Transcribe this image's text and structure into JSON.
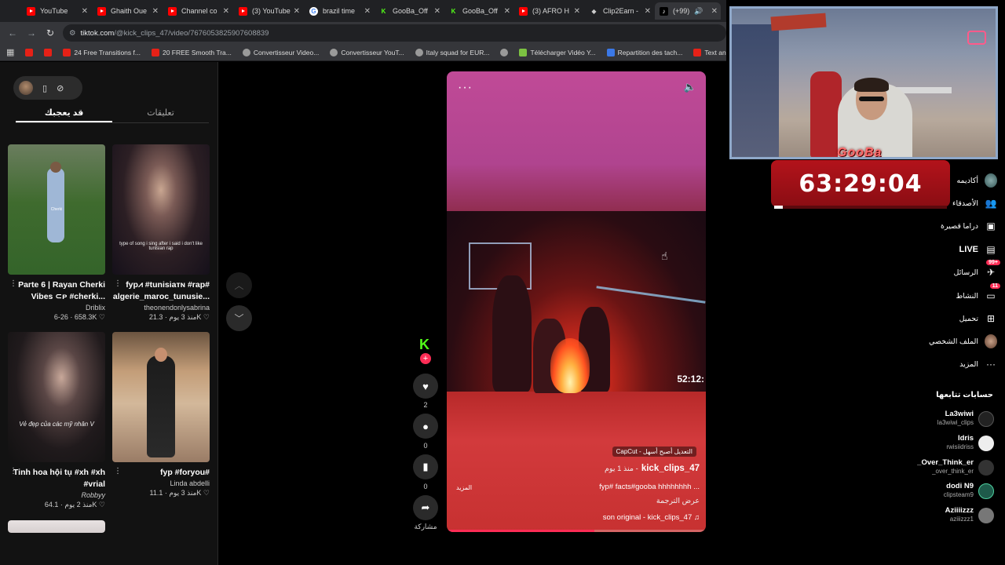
{
  "browser": {
    "tabs": [
      {
        "label": "YouTube",
        "icon": "youtube-icon"
      },
      {
        "label": "Ghaith Oue",
        "icon": "youtube-icon"
      },
      {
        "label": "Channel co",
        "icon": "youtube-icon"
      },
      {
        "label": "(3) YouTube",
        "icon": "youtube-icon"
      },
      {
        "label": "brazil time",
        "icon": "google-icon"
      },
      {
        "label": "GooBa_Off",
        "icon": "kick-icon"
      },
      {
        "label": "GooBa_Off",
        "icon": "kick-icon"
      },
      {
        "label": "(3) AFRO H",
        "icon": "youtube-icon"
      },
      {
        "label": "Clip2Earn -",
        "icon": "clip2earn-icon"
      },
      {
        "label": "‪(+99)‬",
        "icon": "tiktok-icon"
      }
    ],
    "url_host": "tiktok.com",
    "url_path": "/@kick_clips_47/video/7676053825907608839",
    "bookmarks": [
      "24 Free Transitions f...",
      "20 FREE Smooth Tra...",
      "Convertisseur Video...",
      "Convertisseur YouT...",
      "Italy squad for EUR...",
      "Télécharger Vidéo Y...",
      "Repartition des tach...",
      "Text and Image ani..."
    ]
  },
  "left": {
    "tab_liked": "قد يعجبك",
    "tab_comments": "تعليقات",
    "cards": [
      {
        "title_l1": "Parte 6 | Rayan Cherki",
        "title_l2": "Vibes ⊂ᴘ #cherki...",
        "author": "Driblix",
        "meta": "6-26 · 658.3K ♡",
        "caption": "Cherki"
      },
      {
        "title_l1": "fyp⩘ #tunisiaᴛɴ #rap#",
        "title_l2": "algerie_maroc_tunusie...",
        "author": "theonendonlysabrina",
        "meta": "منذ 3 يوم · 21.3K ♡",
        "caption": "type of song i sing after i said i don't like tunisian rap"
      },
      {
        "title_l1": "Tinh hoa hội tụ #xh #xh",
        "title_l2": "#vrial",
        "author": "Robbyy",
        "meta": "منذ 2 يوم · 64.1K ♡",
        "caption": "Vẻ đẹp của các mỹ nhân V"
      },
      {
        "title_l1": "fyp #foryou#",
        "title_l2": "",
        "author": "Linda abdelli",
        "meta": "منذ 3 يوم · 11.1K ♡",
        "caption": ""
      }
    ]
  },
  "video": {
    "overlay_time": "52:12:",
    "capcut": "CapCut - التعديل أصبح أسهل",
    "username": "kick_clips_47",
    "since": "منذ 1 يوم -",
    "description": "fyp# facts#gooba hhhhhhhh ...",
    "more": "المزيد",
    "translate": "عرض الترجمة",
    "sound": "son original - kick_clips_47",
    "progress": 0.57
  },
  "actions": {
    "likes": "2",
    "comments": "0",
    "saves": "0",
    "share": "مشاركة"
  },
  "stream": {
    "gooba_tag": "GooBa",
    "timer": "63:29:04",
    "timer_progress": 0.05
  },
  "right_nav": {
    "items": [
      {
        "label": "أكاديمه",
        "icon": "avatar-icon"
      },
      {
        "label": "الأصدقاء",
        "icon": "friends-icon"
      },
      {
        "label": "دراما قصيرة",
        "icon": "film-icon"
      },
      {
        "label": "LIVE",
        "icon": "live-icon"
      },
      {
        "label": "الرسائل",
        "icon": "messages-icon",
        "badge": "99+"
      },
      {
        "label": "النشاط",
        "icon": "activity-icon",
        "badge": "11"
      },
      {
        "label": "تحميل",
        "icon": "upload-icon"
      },
      {
        "label": "الملف الشخصي",
        "icon": "profile-icon"
      },
      {
        "label": "المزيد",
        "icon": "more-icon"
      }
    ],
    "following_title": "حسابات تتابعها",
    "following": [
      {
        "name": "La3wiwi",
        "handle": "la3wiwi_clips"
      },
      {
        "name": "Idris",
        "handle": "rwisiidriss"
      },
      {
        "name": "_Over_Think_er",
        "handle": "_over_think_er"
      },
      {
        "name": "dodi N9",
        "handle": "clipsteam9"
      },
      {
        "name": "Aziiiizzz",
        "handle": "aziiizzz1"
      }
    ]
  },
  "colors": {
    "accent": "#fe2c55",
    "kick_green": "#53fc18",
    "timer_red": "#b3131b"
  }
}
